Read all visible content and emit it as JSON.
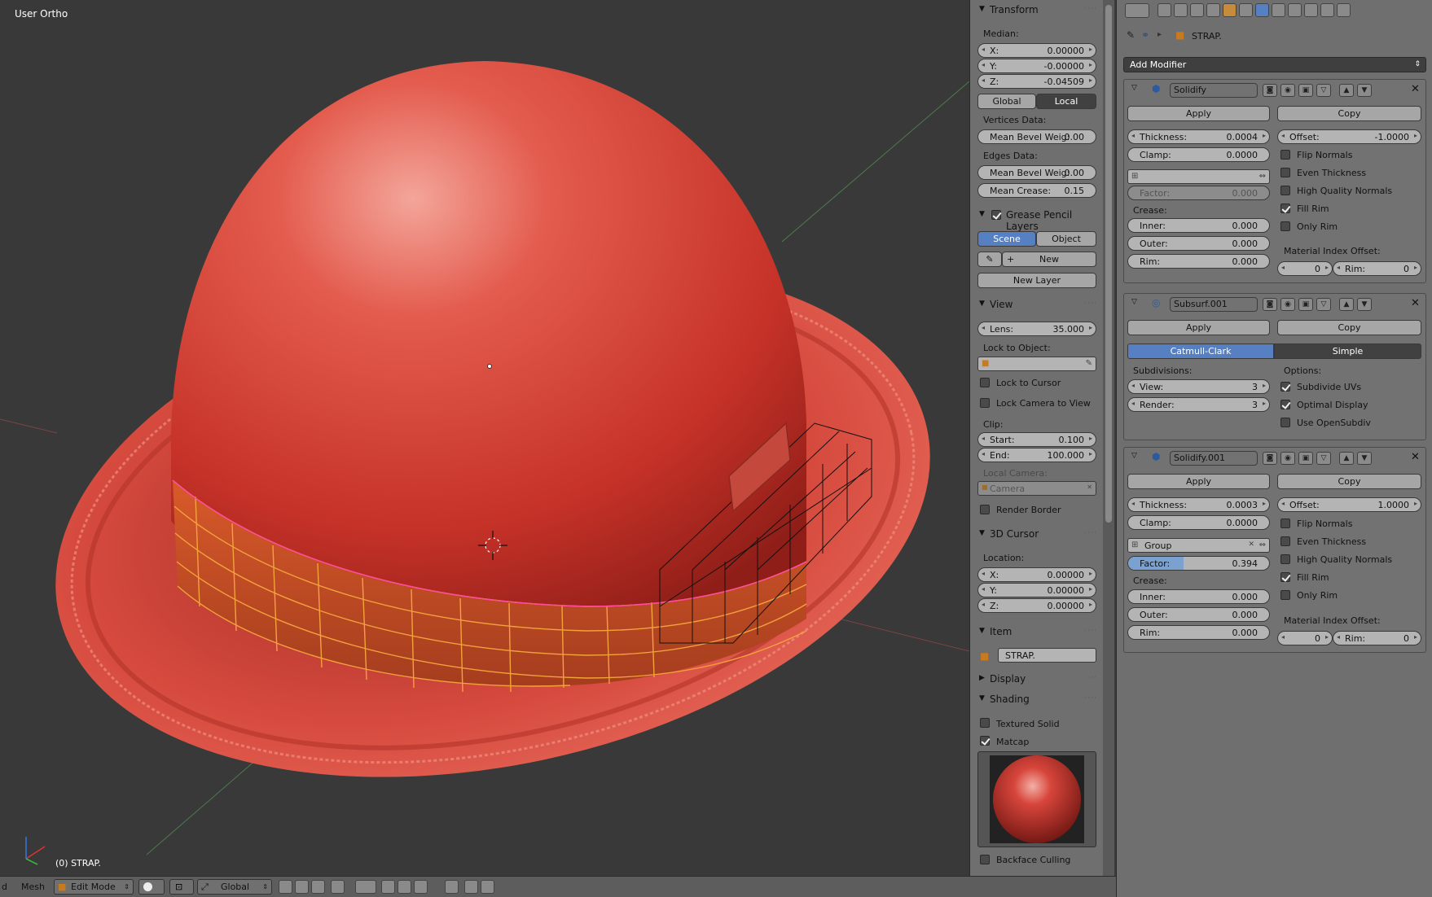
{
  "viewport": {
    "view_label": "User Ortho",
    "object_label": "(0) STRAP."
  },
  "npanel": {
    "transform": {
      "title": "Transform",
      "median_label": "Median:",
      "x": {
        "label": "X:",
        "value": "0.00000"
      },
      "y": {
        "label": "Y:",
        "value": "-0.00000"
      },
      "z": {
        "label": "Z:",
        "value": "-0.04509"
      },
      "global_label": "Global",
      "local_label": "Local",
      "vertices_label": "Vertices Data:",
      "vert_bevel": {
        "label": "Mean Bevel Weig:",
        "value": "0.00"
      },
      "edges_label": "Edges Data:",
      "edge_bevel": {
        "label": "Mean Bevel Weig:",
        "value": "0.00"
      },
      "crease": {
        "label": "Mean Crease:",
        "value": "0.15"
      }
    },
    "grease": {
      "title": "Grease Pencil Layers",
      "scene_label": "Scene",
      "object_label": "Object",
      "new_label": "New",
      "new_layer_label": "New Layer"
    },
    "view": {
      "title": "View",
      "lens": {
        "label": "Lens:",
        "value": "35.000"
      },
      "lock_obj_label": "Lock to Object:",
      "lock_cursor_label": "Lock to Cursor",
      "lock_camera_label": "Lock Camera to View",
      "clip_label": "Clip:",
      "start": {
        "label": "Start:",
        "value": "0.100"
      },
      "end": {
        "label": "End:",
        "value": "100.000"
      },
      "local_camera_label": "Local Camera:",
      "camera_value": "Camera",
      "render_border_label": "Render Border"
    },
    "cursor": {
      "title": "3D Cursor",
      "location_label": "Location:",
      "x": {
        "label": "X:",
        "value": "0.00000"
      },
      "y": {
        "label": "Y:",
        "value": "0.00000"
      },
      "z": {
        "label": "Z:",
        "value": "0.00000"
      }
    },
    "item": {
      "title": "Item",
      "name": "STRAP."
    },
    "display": {
      "title": "Display"
    },
    "shading": {
      "title": "Shading",
      "textured_label": "Textured Solid",
      "matcap_label": "Matcap",
      "backface_label": "Backface Culling"
    }
  },
  "props": {
    "breadcrumb_name": "STRAP.",
    "add_modifier_label": "Add Modifier",
    "solidify": {
      "name": "Solidify",
      "apply_label": "Apply",
      "copy_label": "Copy",
      "thickness": {
        "label": "Thickness:",
        "value": "0.0004"
      },
      "clamp": {
        "label": "Clamp:",
        "value": "0.0000"
      },
      "offset": {
        "label": "Offset:",
        "value": "-1.0000"
      },
      "flip_label": "Flip Normals",
      "even_label": "Even Thickness",
      "hq_label": "High Quality Normals",
      "fill_label": "Fill Rim",
      "only_label": "Only Rim",
      "factor": {
        "label": "Factor:",
        "value": "0.000"
      },
      "crease_label": "Crease:",
      "inner": {
        "label": "Inner:",
        "value": "0.000"
      },
      "outer": {
        "label": "Outer:",
        "value": "0.000"
      },
      "rim": {
        "label": "Rim:",
        "value": "0.000"
      },
      "mat_label": "Material Index Offset:",
      "mat_value": "0",
      "mat_rim": {
        "label": "Rim:",
        "value": "0"
      }
    },
    "subsurf": {
      "name": "Subsurf.001",
      "apply_label": "Apply",
      "copy_label": "Copy",
      "catmull_label": "Catmull-Clark",
      "simple_label": "Simple",
      "subdiv_label": "Subdivisions:",
      "options_label": "Options:",
      "view": {
        "label": "View:",
        "value": "3"
      },
      "render": {
        "label": "Render:",
        "value": "3"
      },
      "uv_label": "Subdivide UVs",
      "optimal_label": "Optimal Display",
      "opensubdiv_label": "Use OpenSubdiv"
    },
    "solidify2": {
      "name": "Solidify.001",
      "apply_label": "Apply",
      "copy_label": "Copy",
      "thickness": {
        "label": "Thickness:",
        "value": "0.0003"
      },
      "clamp": {
        "label": "Clamp:",
        "value": "0.0000"
      },
      "offset": {
        "label": "Offset:",
        "value": "1.0000"
      },
      "flip_label": "Flip Normals",
      "even_label": "Even Thickness",
      "hq_label": "High Quality Normals",
      "fill_label": "Fill Rim",
      "only_label": "Only Rim",
      "group_value": "Group",
      "factor": {
        "label": "Factor:",
        "value": "0.394",
        "fraction": 0.394
      },
      "crease_label": "Crease:",
      "inner": {
        "label": "Inner:",
        "value": "0.000"
      },
      "outer": {
        "label": "Outer:",
        "value": "0.000"
      },
      "rim": {
        "label": "Rim:",
        "value": "0.000"
      },
      "mat_label": "Material Index Offset:",
      "mat_value": "0",
      "mat_rim": {
        "label": "Rim:",
        "value": "0"
      }
    }
  },
  "bottombar": {
    "view_menu": "d",
    "mesh_menu": "Mesh",
    "mode_label": "Edit Mode",
    "orientation_label": "Global"
  },
  "colors": {
    "hat": "#d8473e",
    "band_wire": "#f3a23c",
    "select_blue": "#5680c2"
  }
}
